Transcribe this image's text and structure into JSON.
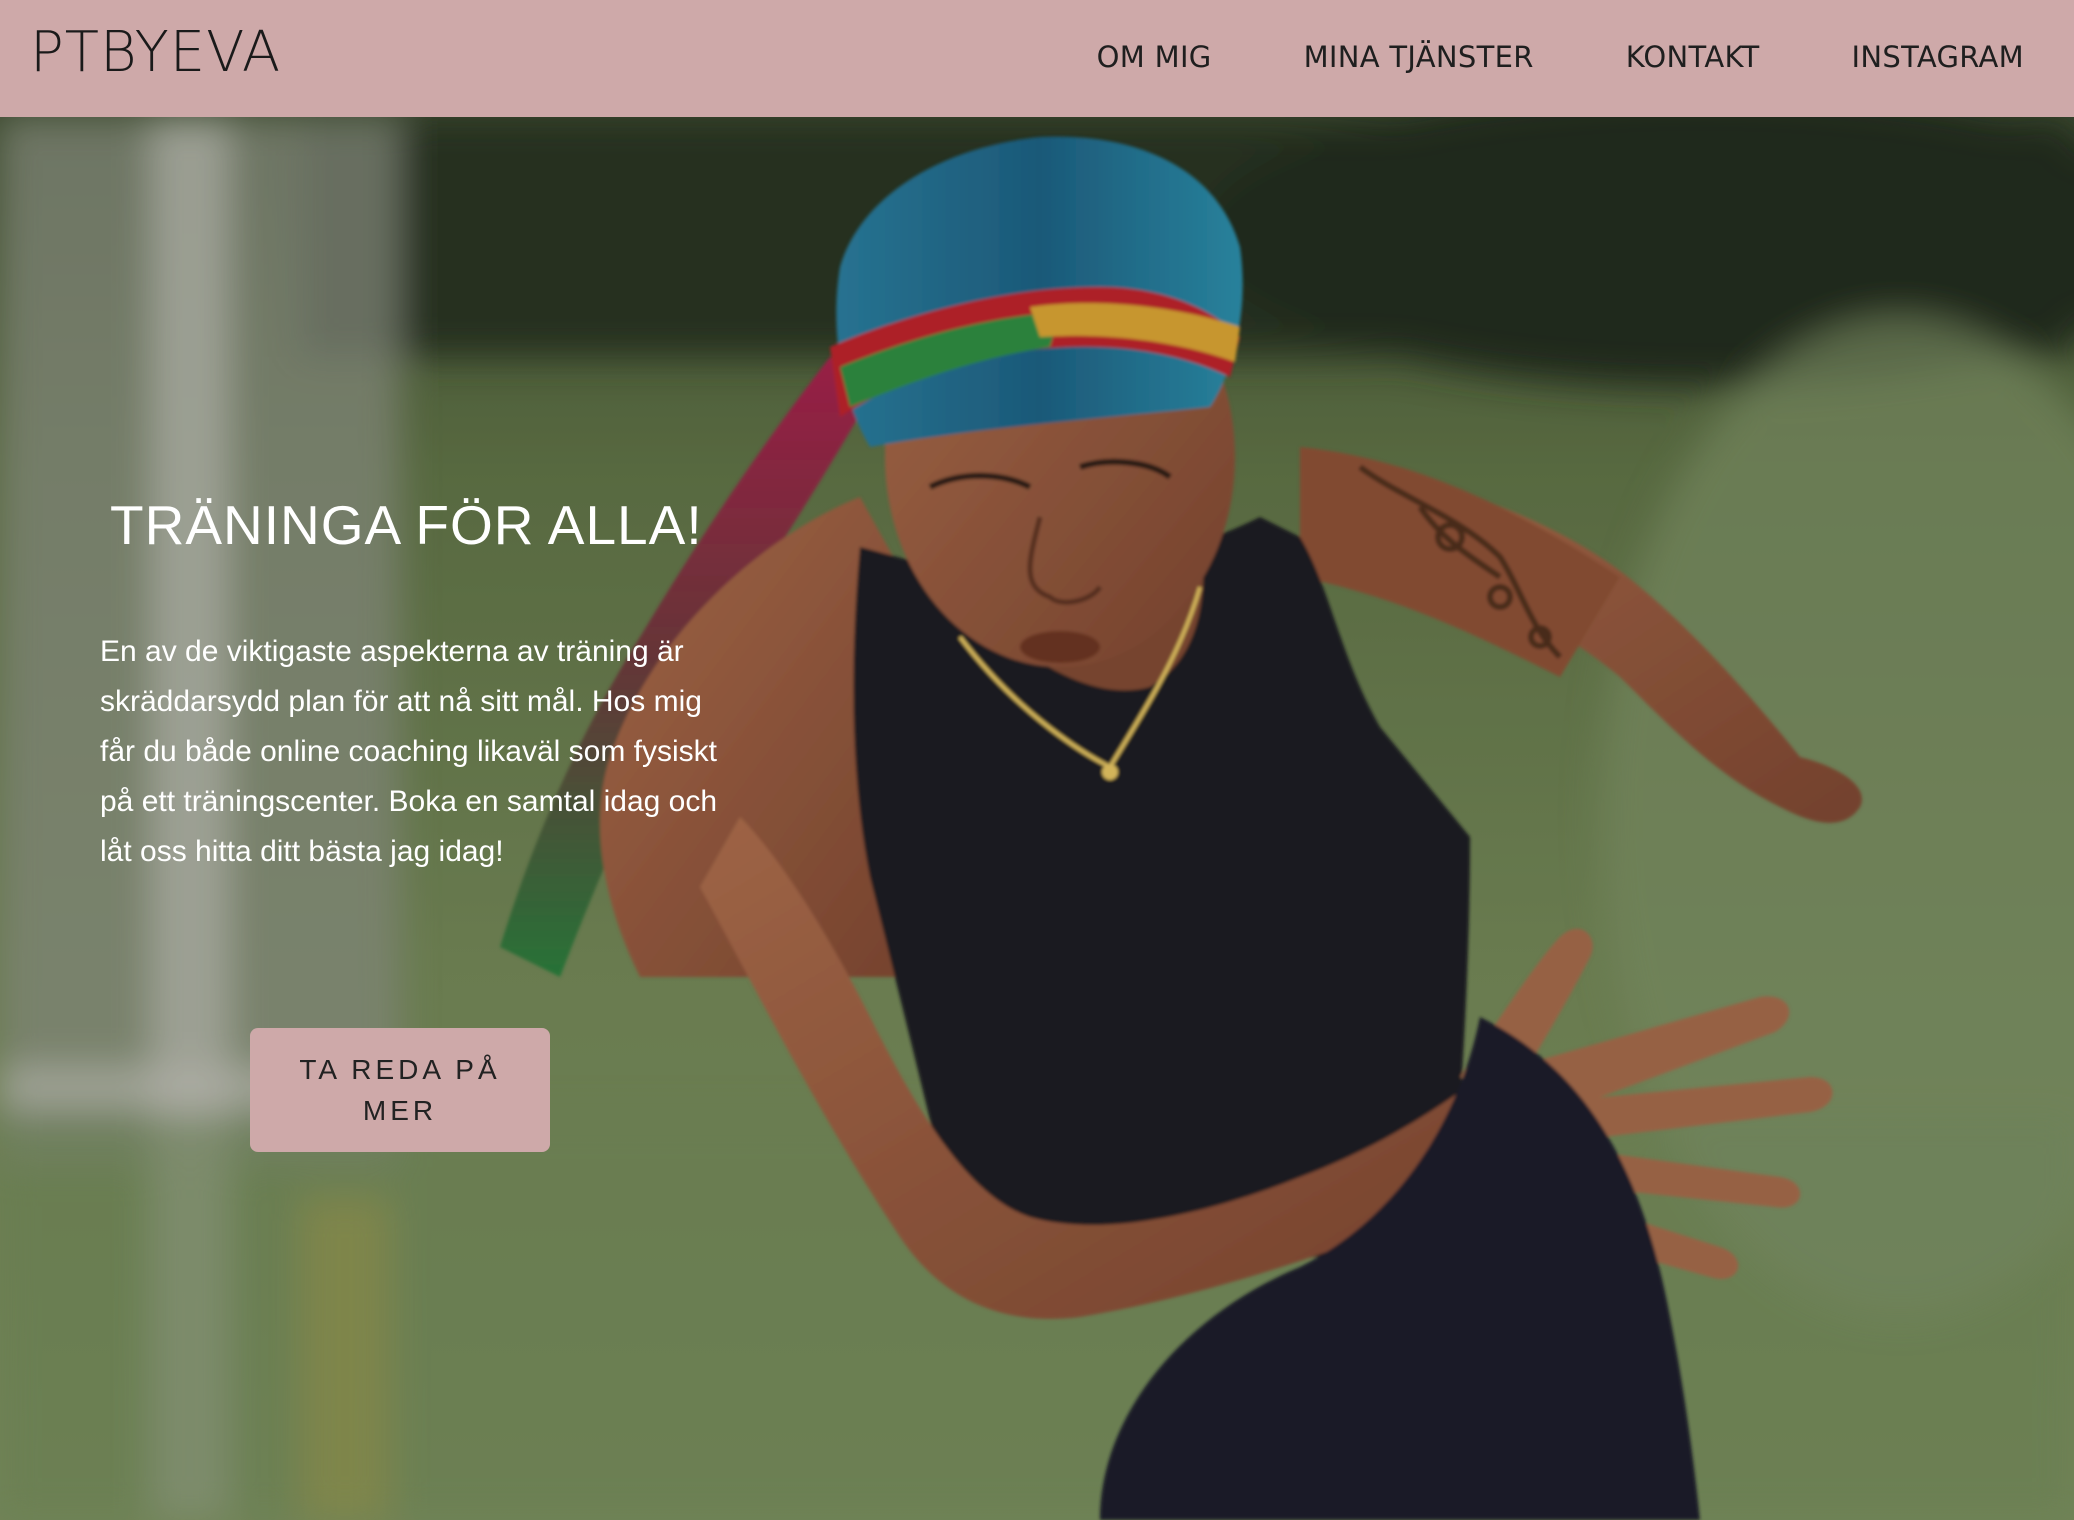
{
  "header": {
    "logo": "PTBYEVA",
    "nav": [
      {
        "label": "OM MIG"
      },
      {
        "label": "MINA TJÄNSTER"
      },
      {
        "label": "KONTAKT"
      },
      {
        "label": "INSTAGRAM"
      }
    ]
  },
  "hero": {
    "title": "TRÄNINGA FÖR ALLA!",
    "text": "En av de viktigaste aspekterna av träning är skräddarsydd plan för att nå sitt mål. Hos mig får du både online coaching likaväl som fysiskt på ett träningscenter. Boka en samtal idag och låt oss hitta ditt bästa jag idag!",
    "cta_label": "TA REDA PÅ MER"
  },
  "colors": {
    "brand": "#cea9a9",
    "text_dark": "#1f1f1f",
    "hero_text": "#ffffff"
  }
}
